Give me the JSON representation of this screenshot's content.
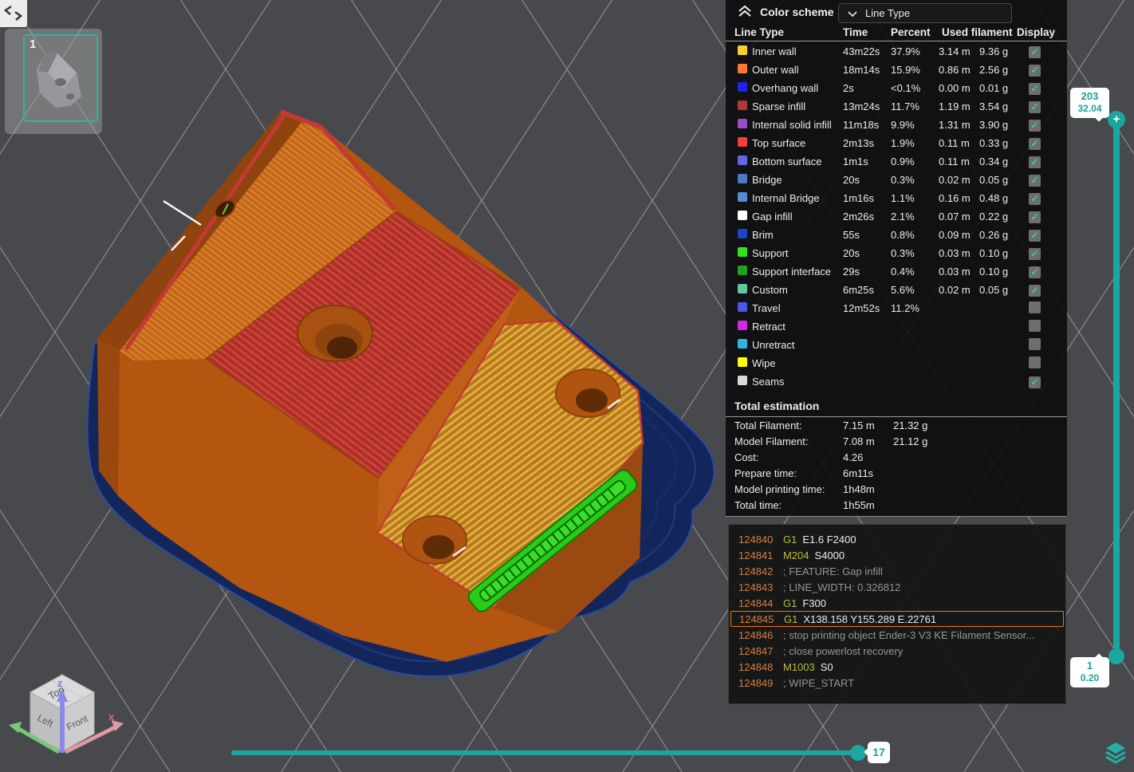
{
  "palette": {
    "accent_teal": "#1CA6A0",
    "check_mark": "#2BD3B7",
    "highlight_border": "#E8770F",
    "gcode_line_number": "#D08045",
    "gcode_command": "#B8BC43",
    "gcode_comment": "#969696",
    "brim_blue": "#13265B",
    "body_orange": "#B45510",
    "top_surface_red": "#A93028",
    "deck_gold": "#B57A1E",
    "strip_green": "#28CC19"
  },
  "thumbnail": {
    "plate_label": "1"
  },
  "legend": {
    "title": "Color scheme",
    "dropdown": {
      "value": "Line Type"
    },
    "columns": [
      "Line Type",
      "Time",
      "Percent",
      "Used filament",
      "Display"
    ],
    "rows": [
      {
        "label": "Inner wall",
        "color": "#FFCE2B",
        "time": "43m22s",
        "percent": "37.9%",
        "used_m": "3.14 m",
        "used_g": "9.36 g",
        "checked": true
      },
      {
        "label": "Outer wall",
        "color": "#FF7A2E",
        "time": "18m14s",
        "percent": "15.9%",
        "used_m": "0.86 m",
        "used_g": "2.56 g",
        "checked": true
      },
      {
        "label": "Overhang wall",
        "color": "#2022F0",
        "time": "2s",
        "percent": "<0.1%",
        "used_m": "0.00 m",
        "used_g": "0.01 g",
        "checked": true
      },
      {
        "label": "Sparse infill",
        "color": "#AF3933",
        "time": "13m24s",
        "percent": "11.7%",
        "used_m": "1.19 m",
        "used_g": "3.54 g",
        "checked": true
      },
      {
        "label": "Internal solid infill",
        "color": "#984FC6",
        "time": "11m18s",
        "percent": "9.9%",
        "used_m": "1.31 m",
        "used_g": "3.90 g",
        "checked": true
      },
      {
        "label": "Top surface",
        "color": "#F23F3F",
        "time": "2m13s",
        "percent": "1.9%",
        "used_m": "0.11 m",
        "used_g": "0.33 g",
        "checked": true
      },
      {
        "label": "Bottom surface",
        "color": "#6466E0",
        "time": "1m1s",
        "percent": "0.9%",
        "used_m": "0.11 m",
        "used_g": "0.34 g",
        "checked": true
      },
      {
        "label": "Bridge",
        "color": "#4E79C3",
        "time": "20s",
        "percent": "0.3%",
        "used_m": "0.02 m",
        "used_g": "0.05 g",
        "checked": true
      },
      {
        "label": "Internal Bridge",
        "color": "#4F8FD2",
        "time": "1m16s",
        "percent": "1.1%",
        "used_m": "0.16 m",
        "used_g": "0.48 g",
        "checked": true
      },
      {
        "label": "Gap infill",
        "color": "#FFFFFF",
        "time": "2m26s",
        "percent": "2.1%",
        "used_m": "0.07 m",
        "used_g": "0.22 g",
        "checked": true
      },
      {
        "label": "Brim",
        "color": "#1A45CC",
        "time": "55s",
        "percent": "0.8%",
        "used_m": "0.09 m",
        "used_g": "0.26 g",
        "checked": true
      },
      {
        "label": "Support",
        "color": "#33E11B",
        "time": "20s",
        "percent": "0.3%",
        "used_m": "0.03 m",
        "used_g": "0.10 g",
        "checked": true
      },
      {
        "label": "Support interface",
        "color": "#21A121",
        "time": "29s",
        "percent": "0.4%",
        "used_m": "0.03 m",
        "used_g": "0.10 g",
        "checked": true
      },
      {
        "label": "Custom",
        "color": "#63C89F",
        "time": "6m25s",
        "percent": "5.6%",
        "used_m": "0.02 m",
        "used_g": "0.05 g",
        "checked": true
      },
      {
        "label": "Travel",
        "color": "#4C55E4",
        "time": "12m52s",
        "percent": "11.2%",
        "used_m": "",
        "used_g": "",
        "checked": false
      },
      {
        "label": "Retract",
        "color": "#D32ADF",
        "time": "",
        "percent": "",
        "used_m": "",
        "used_g": "",
        "checked": false
      },
      {
        "label": "Unretract",
        "color": "#32B4DC",
        "time": "",
        "percent": "",
        "used_m": "",
        "used_g": "",
        "checked": false
      },
      {
        "label": "Wipe",
        "color": "#FFFF00",
        "time": "",
        "percent": "",
        "used_m": "",
        "used_g": "",
        "checked": false
      },
      {
        "label": "Seams",
        "color": "#D9D9D9",
        "time": "",
        "percent": "",
        "used_m": "",
        "used_g": "",
        "checked": true
      }
    ]
  },
  "totals": {
    "title": "Total estimation",
    "rows": [
      {
        "label": "Total Filament:",
        "v1": "7.15 m",
        "v2": "21.32 g"
      },
      {
        "label": "Model Filament:",
        "v1": "7.08 m",
        "v2": "21.12 g"
      },
      {
        "label": "Cost:",
        "v1": "4.26",
        "v2": ""
      },
      {
        "label": "Prepare time:",
        "v1": "6m11s",
        "v2": ""
      },
      {
        "label": "Model printing time:",
        "v1": "1h48m",
        "v2": ""
      },
      {
        "label": "Total time:",
        "v1": "1h55m",
        "v2": ""
      }
    ]
  },
  "gcode": {
    "lines": [
      {
        "n": "124840",
        "cmd": "G1",
        "args": "E1.6 F2400",
        "comment": "",
        "highlight": false
      },
      {
        "n": "124841",
        "cmd": "M204",
        "args": "S4000",
        "comment": "",
        "highlight": false
      },
      {
        "n": "124842",
        "cmd": "",
        "args": "",
        "comment": "; FEATURE: Gap infill",
        "highlight": false
      },
      {
        "n": "124843",
        "cmd": "",
        "args": "",
        "comment": "; LINE_WIDTH: 0.326812",
        "highlight": false
      },
      {
        "n": "124844",
        "cmd": "G1",
        "args": "F300",
        "comment": "",
        "highlight": false
      },
      {
        "n": "124845",
        "cmd": "G1",
        "args": "X138.158 Y155.289 E.22761",
        "comment": "",
        "highlight": true
      },
      {
        "n": "124846",
        "cmd": "",
        "args": "",
        "comment": "; stop printing object Ender-3 V3 KE Filament Sensor...",
        "highlight": false
      },
      {
        "n": "124847",
        "cmd": "",
        "args": "",
        "comment": "; close powerlost recovery",
        "highlight": false
      },
      {
        "n": "124848",
        "cmd": "M1003",
        "args": "S0",
        "comment": "",
        "highlight": false
      },
      {
        "n": "124849",
        "cmd": "",
        "args": "",
        "comment": "; WIPE_START",
        "highlight": false
      }
    ]
  },
  "sliders": {
    "vertical": {
      "top_value": "203",
      "top_height": "32.04",
      "bottom_value": "1",
      "bottom_height": "0.20"
    },
    "horizontal": {
      "value": "17"
    }
  },
  "nav_cube": {
    "top": "Top",
    "left": "Left",
    "front": "Front",
    "axis_z": "z",
    "axis_x": "x"
  }
}
